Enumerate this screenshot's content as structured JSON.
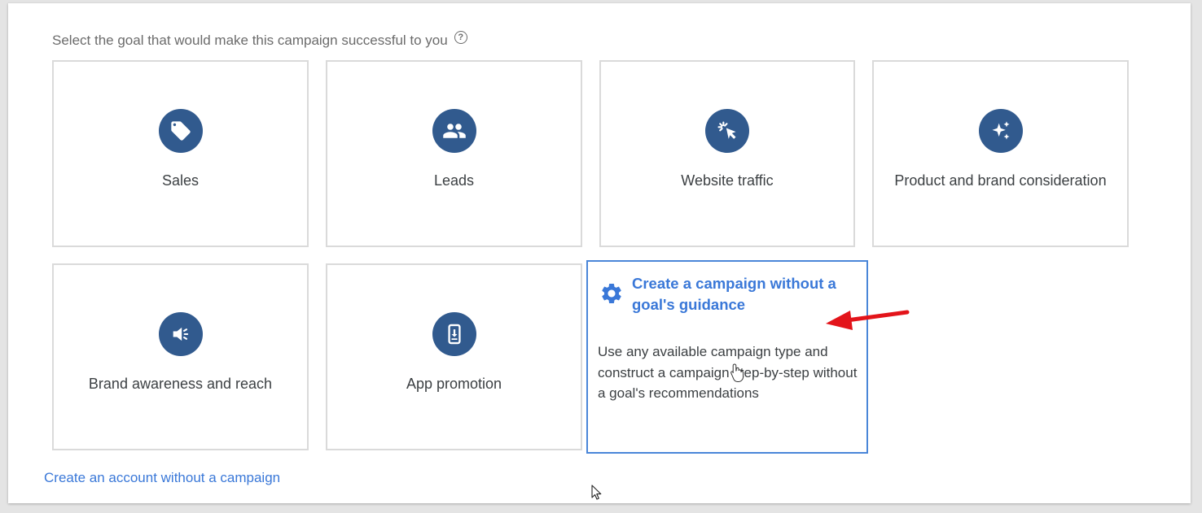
{
  "prompt": {
    "text": "Select the goal that would make this campaign successful to you",
    "help_glyph": "?"
  },
  "goals": [
    {
      "label": "Sales",
      "icon": "tag-icon"
    },
    {
      "label": "Leads",
      "icon": "people-icon"
    },
    {
      "label": "Website traffic",
      "icon": "cursor-click-icon"
    },
    {
      "label": "Product and brand consideration",
      "icon": "sparkle-icon"
    },
    {
      "label": "Brand awareness and reach",
      "icon": "megaphone-icon"
    },
    {
      "label": "App promotion",
      "icon": "phone-download-icon"
    }
  ],
  "no_goal_option": {
    "title": "Create a campaign without a goal's guidance",
    "description": "Use any available campaign type and construct a campaign step-by-step without a goal's recommendations",
    "icon": "gear-icon",
    "selected": true
  },
  "footer": {
    "link_text": "Create an account without a campaign"
  },
  "colors": {
    "icon_bg": "#315a8e",
    "accent": "#3a78d8",
    "selected_border": "#4a86d8",
    "annotation_arrow": "#e3141a"
  }
}
